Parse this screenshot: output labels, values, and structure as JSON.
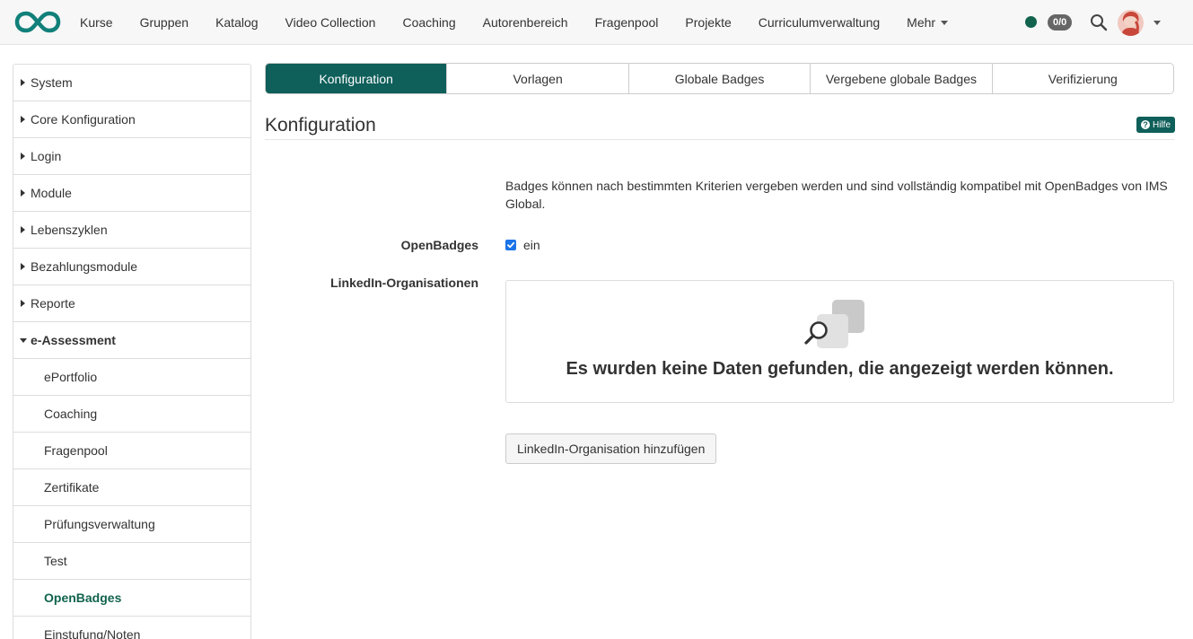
{
  "topnav": {
    "logo": "openolat-infinity-logo",
    "items": [
      "Kurse",
      "Gruppen",
      "Katalog",
      "Video Collection",
      "Coaching",
      "Autorenbereich",
      "Fragenpool",
      "Projekte",
      "Curriculumverwaltung",
      "Mehr"
    ],
    "status_badge": "0/0",
    "status_color": "#11634e",
    "icons": [
      "search-icon",
      "avatar",
      "chevron-down-icon"
    ]
  },
  "sidebar": {
    "items": [
      {
        "label": "System"
      },
      {
        "label": "Core Konfiguration"
      },
      {
        "label": "Login"
      },
      {
        "label": "Module"
      },
      {
        "label": "Lebenszyklen"
      },
      {
        "label": "Bezahlungsmodule"
      },
      {
        "label": "Reporte"
      },
      {
        "label": "e-Assessment"
      }
    ],
    "subitems": [
      {
        "label": "ePortfolio"
      },
      {
        "label": "Coaching"
      },
      {
        "label": "Fragenpool"
      },
      {
        "label": "Zertifikate"
      },
      {
        "label": "Prüfungsverwaltung"
      },
      {
        "label": "Test"
      },
      {
        "label": "OpenBadges"
      },
      {
        "label": "Einstufung/Noten"
      }
    ],
    "active_item": "OpenBadges"
  },
  "tabs": [
    {
      "label": "Konfiguration",
      "active": true
    },
    {
      "label": "Vorlagen",
      "active": false
    },
    {
      "label": "Globale Badges",
      "active": false
    },
    {
      "label": "Vergebene globale Badges",
      "active": false
    },
    {
      "label": "Verifizierung",
      "active": false
    }
  ],
  "page": {
    "title": "Konfiguration",
    "help_label": "Hilfe"
  },
  "form": {
    "description": "Badges können nach bestimmten Kriterien vergeben werden und sind vollständig kompatibel mit OpenBadges von IMS Global.",
    "openbadges_label": "OpenBadges",
    "openbadges_checkbox_label": "ein",
    "openbadges_checked": true,
    "linkedin_label": "LinkedIn-Organisationen",
    "empty_message": "Es wurden keine Daten gefunden, die angezeigt werden können.",
    "add_button": "LinkedIn-Organisation hinzufügen"
  },
  "colors": {
    "accent": "#0f5f5a",
    "checkbox": "#1a73e8"
  }
}
